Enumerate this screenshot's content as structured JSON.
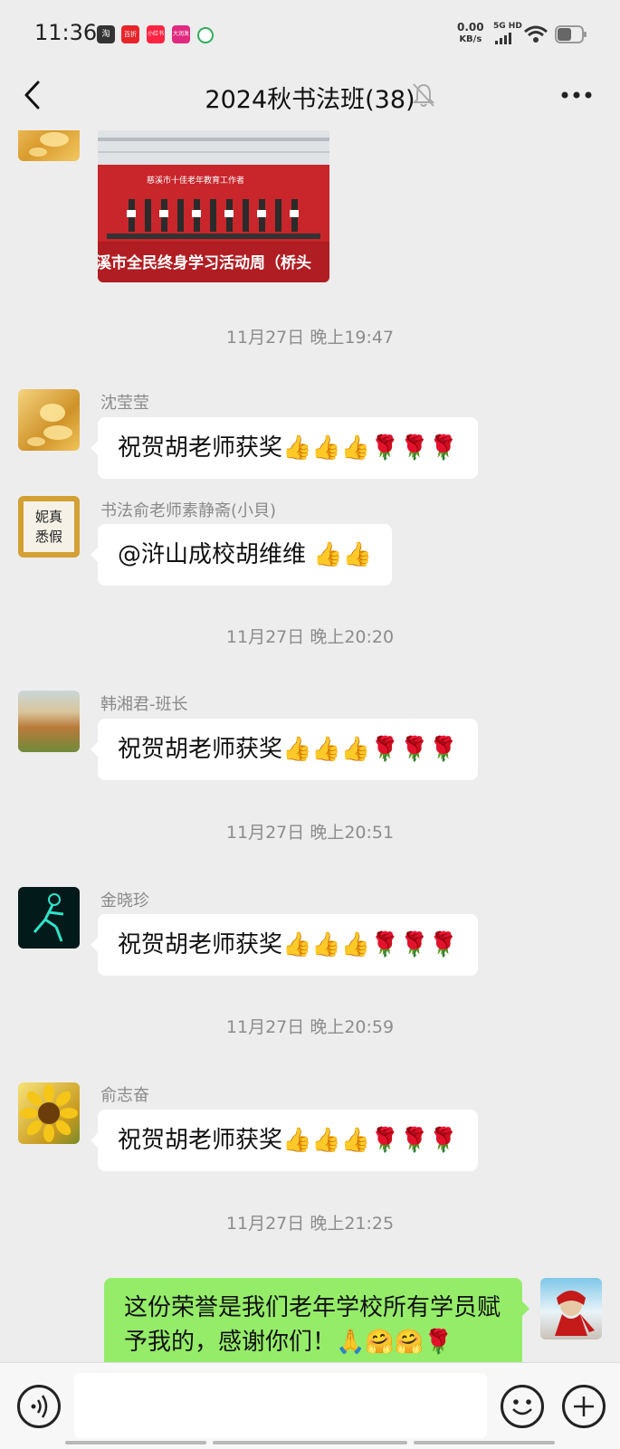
{
  "status_bar": {
    "time": "11:36",
    "app_icons": [
      {
        "label": "淘",
        "color": "#333333"
      },
      {
        "label": "百折",
        "color": "#e8242b"
      },
      {
        "label": "小红书",
        "color": "#ff2442"
      },
      {
        "label": "大润发",
        "color": "#e02a80"
      },
      {
        "label": "",
        "color": "#2fae5a"
      }
    ],
    "net_speed": "0.00",
    "net_unit": "KB/s",
    "net_badge": "5G HD"
  },
  "header": {
    "title": "2024秋书法班(38)"
  },
  "photo": {
    "banner_text": "溪市全民终身学习活动周（桥头",
    "board_text": "慈溪市十佳老年教育工作者"
  },
  "messages": [
    {
      "type": "timestamp",
      "text": "11月27日 晚上19:47"
    },
    {
      "type": "msg",
      "sender": "沈莹莹",
      "text": "祝贺胡老师获奖👍👍👍🌹🌹🌹"
    },
    {
      "type": "msg",
      "sender": "书法俞老师素静斋(小貝)",
      "text": "@浒山成校胡维维 👍👍",
      "avatar_text": "妮真\n悉假"
    },
    {
      "type": "timestamp",
      "text": "11月27日 晚上20:20"
    },
    {
      "type": "msg",
      "sender": "韩湘君-班长",
      "text": "祝贺胡老师获奖👍👍👍🌹🌹🌹"
    },
    {
      "type": "timestamp",
      "text": "11月27日 晚上20:51"
    },
    {
      "type": "msg",
      "sender": "金晓珍",
      "text": "祝贺胡老师获奖👍👍👍🌹🌹🌹"
    },
    {
      "type": "timestamp",
      "text": "11月27日 晚上20:59"
    },
    {
      "type": "msg",
      "sender": "俞志奋",
      "text": "祝贺胡老师获奖👍👍👍🌹🌹🌹"
    },
    {
      "type": "timestamp",
      "text": "11月27日 晚上21:25"
    },
    {
      "type": "own",
      "text": "这份荣誉是我们老年学校所有学员赋予我的，感谢你们！🙏🤗🤗🌹"
    }
  ],
  "input": {
    "placeholder": ""
  },
  "icons": {
    "back": "back-arrow-icon",
    "mute": "bell-muted-icon",
    "more": "more-dots-icon",
    "voice": "voice-icon",
    "emoji": "emoji-icon",
    "plus": "plus-icon"
  },
  "colors": {
    "background": "#ededed",
    "own_bubble": "#95ec69",
    "other_bubble": "#ffffff",
    "timestamp": "#8c8c8c"
  }
}
